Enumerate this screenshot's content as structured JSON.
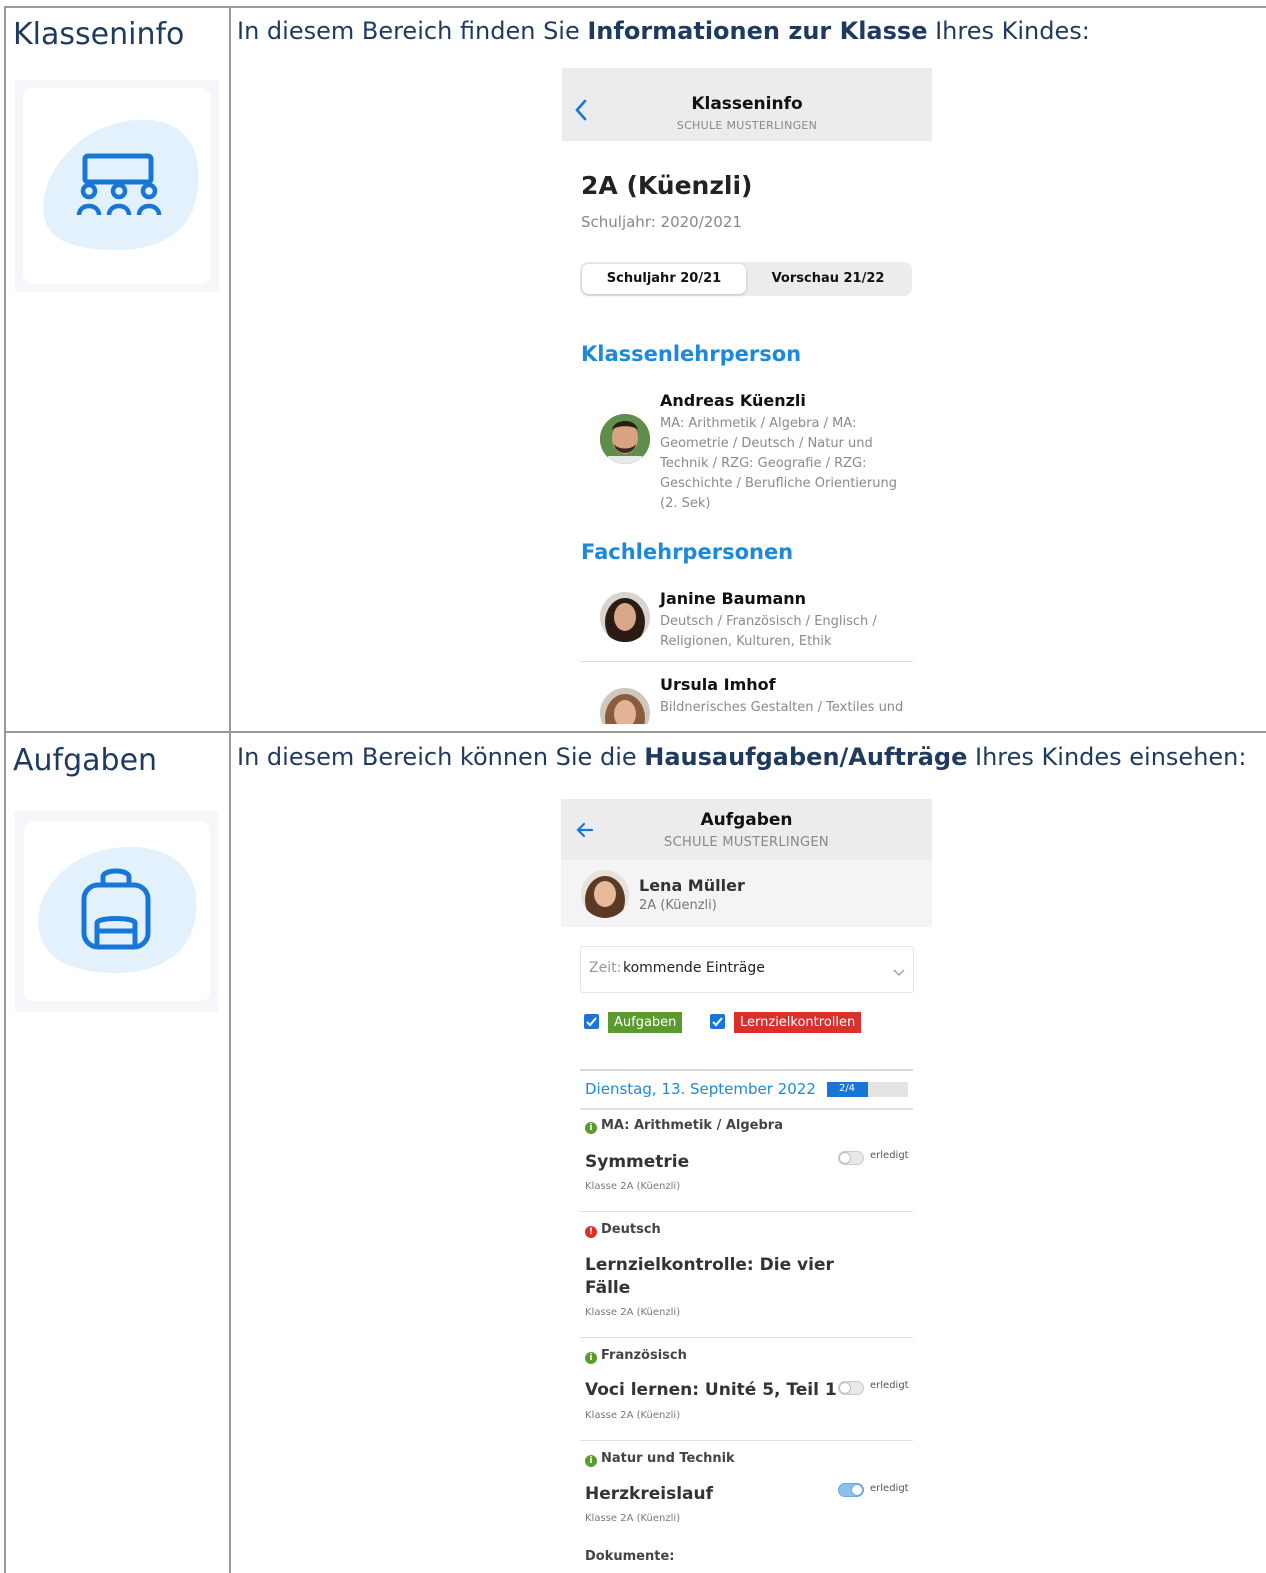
{
  "klasseninfo": {
    "row_title": "Klasseninfo",
    "intro_before": "In diesem Bereich finden Sie ",
    "intro_bold": "Informationen zur Klasse",
    "intro_after": " Ihres Kindes:",
    "icon": "classroom-icon",
    "screen": {
      "title": "Klasseninfo",
      "subtitle": "SCHULE MUSTERLINGEN",
      "class_name": "2A (Küenzli)",
      "school_year": "Schuljahr: 2020/2021",
      "tabs": [
        {
          "label": "Schuljahr 20/21",
          "active": true
        },
        {
          "label": "Vorschau 21/22",
          "active": false
        }
      ],
      "class_teacher_heading": "Klassenlehrperson",
      "class_teacher": {
        "name": "Andreas Küenzli",
        "subjects": "MA: Arithmetik / Algebra / MA: Geometrie / Deutsch / Natur und Technik / RZG: Geografie / RZG: Geschichte / Berufliche Orientierung (2. Sek)"
      },
      "subject_teachers_heading": "Fachlehrpersonen",
      "subject_teachers": [
        {
          "name": "Janine Baumann",
          "subjects": "Deutsch / Französisch / Englisch / Religionen, Kulturen, Ethik"
        },
        {
          "name": "Ursula Imhof",
          "subjects": "Bildnerisches Gestalten / Textiles und"
        }
      ]
    }
  },
  "aufgaben": {
    "row_title": "Aufgaben",
    "intro_before": "In diesem Bereich können Sie die ",
    "intro_bold": "Hausaufgaben/Aufträge",
    "intro_after": " Ihres Kindes einsehen:",
    "icon": "backpack-icon",
    "screen": {
      "title": "Aufgaben",
      "subtitle": "SCHULE MUSTERLINGEN",
      "student_name": "Lena Müller",
      "student_class": "2A (Küenzli)",
      "time_label": "Zeit:",
      "time_value": "kommende Einträge",
      "filter_tasks": "Aufgaben",
      "filter_exams": "Lernzielkontrollen",
      "date": "Dienstag, 13. September 2022",
      "progress_text": "2/4",
      "progress_fraction": 0.5,
      "done_label": "erledigt",
      "items": [
        {
          "subject": "MA: Arithmetik / Algebra",
          "title": "Symmetrie",
          "class": "Klasse 2A (Küenzli)",
          "type": "task",
          "done": false
        },
        {
          "subject": "Deutsch",
          "title": "Lernzielkontrolle: Die vier Fälle",
          "class": "Klasse 2A (Küenzli)",
          "type": "exam",
          "done": false
        },
        {
          "subject": "Französisch",
          "title": "Voci lernen: Unité 5, Teil 1",
          "class": "Klasse 2A (Küenzli)",
          "type": "task",
          "done": false
        },
        {
          "subject": "Natur und Technik",
          "title": "Herzkreislauf",
          "class": "Klasse 2A (Küenzli)",
          "type": "task",
          "done": true
        }
      ],
      "documents_label": "Dokumente:"
    }
  },
  "colors": {
    "accent_blue": "#1c8ad8",
    "task_green": "#5b9a2e",
    "exam_red": "#d9302c"
  }
}
